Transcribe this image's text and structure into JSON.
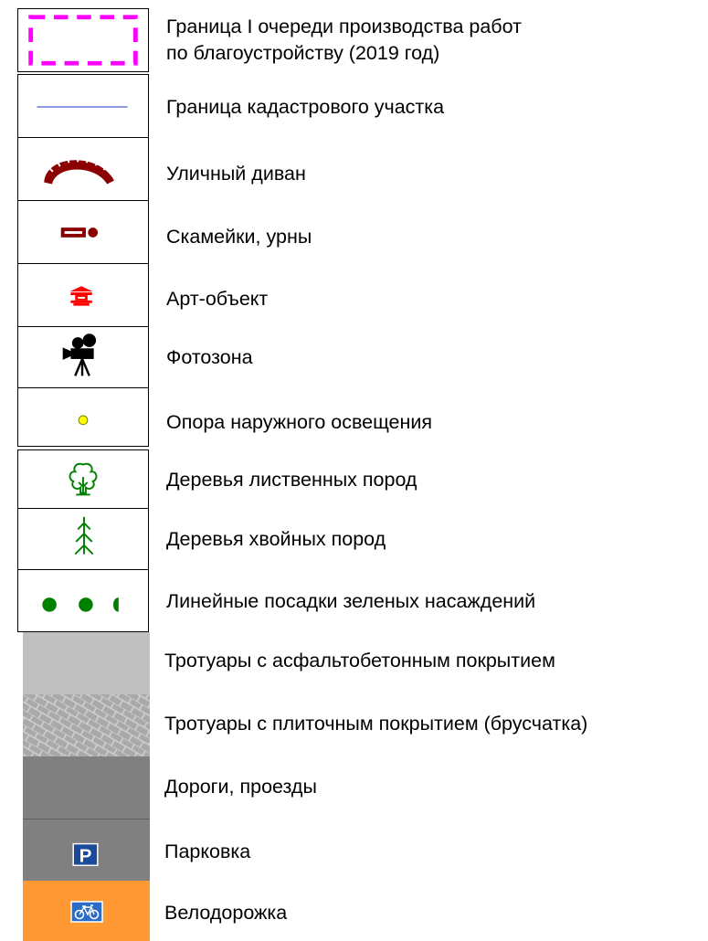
{
  "legend": {
    "items": [
      {
        "symbol": "magenta-dashed-rectangle",
        "label": "Граница I очереди производства работ по благоустройству (2019 год)",
        "label_lines": [
          "Граница I очереди производства работ",
          "по благоустройству (2019 год)"
        ]
      },
      {
        "symbol": "blue-thin-line",
        "label": "Граница кадастрового участка"
      },
      {
        "symbol": "street-sofa-icon",
        "label": "Уличный диван"
      },
      {
        "symbol": "bench-and-bin-icon",
        "label": "Скамейки, урны"
      },
      {
        "symbol": "art-object-icon",
        "label": "Арт-объект"
      },
      {
        "symbol": "movie-camera-icon",
        "label": "Фотозона"
      },
      {
        "symbol": "yellow-dot-icon",
        "label": "Опора наружного освещения"
      },
      {
        "symbol": "deciduous-tree-icon",
        "label": "Деревья лиственных пород"
      },
      {
        "symbol": "conifer-tree-icon",
        "label": "Деревья хвойных пород"
      },
      {
        "symbol": "green-dots-icon",
        "label": "Линейные посадки зеленых насаждений"
      },
      {
        "symbol": "light-gray-fill",
        "label": "Тротуары с асфальтобетонным покрытием"
      },
      {
        "symbol": "cobblestone-pattern",
        "label": "Тротуары с плиточным покрытием (брусчатка)"
      },
      {
        "symbol": "dark-gray-fill",
        "label": "Дороги, проезды"
      },
      {
        "symbol": "parking-sign-icon",
        "label": "Парковка"
      },
      {
        "symbol": "bicycle-sign-icon",
        "label": "Велодорожка"
      }
    ]
  },
  "colors": {
    "border_dash": "#ff00ff",
    "cadastral_line": "#2233cc",
    "furniture": "#8b0000",
    "art_object": "#ff0000",
    "photo_zone": "#000000",
    "lamp_fill": "#ffff00",
    "tree_green": "#008000",
    "sidewalk_asphalt": "#c0c0c0",
    "sidewalk_tile": "#a8a8a8",
    "road": "#808080",
    "parking_sign": "#1a4a9a",
    "bike_lane": "#ff9933",
    "bike_sign": "#2a6cc8"
  }
}
